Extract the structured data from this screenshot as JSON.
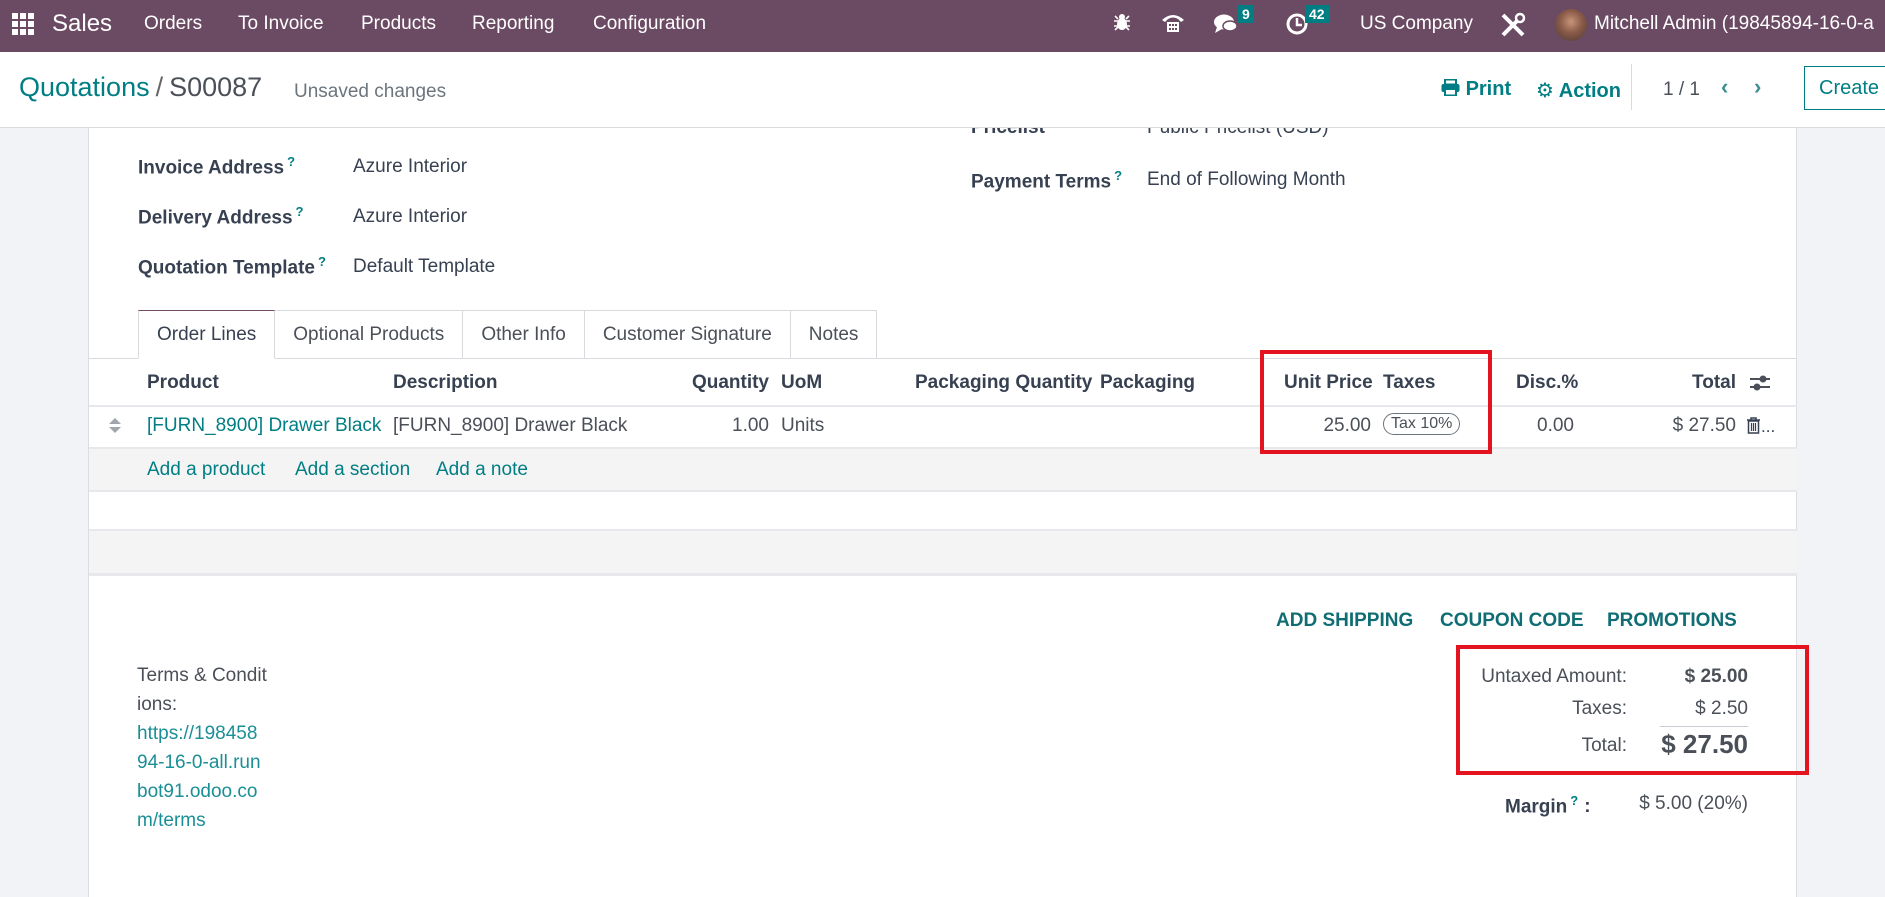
{
  "navbar": {
    "app_name": "Sales",
    "menu": [
      "Orders",
      "To Invoice",
      "Products",
      "Reporting",
      "Configuration"
    ],
    "messages_count": "9",
    "activities_count": "42",
    "company": "US Company",
    "user": "Mitchell Admin (19845894-16-0-a"
  },
  "control_panel": {
    "breadcrumb_parent": "Quotations",
    "breadcrumb_separator": "/",
    "record_name": "S00087",
    "status": "Unsaved changes",
    "print_label": "Print",
    "action_label": "Action",
    "pager": "1 / 1",
    "create_label": "Create"
  },
  "form": {
    "left_fields": [
      {
        "label": "Invoice Address",
        "value": "Azure Interior"
      },
      {
        "label": "Delivery Address",
        "value": "Azure Interior"
      },
      {
        "label": "Quotation Template",
        "value": "Default Template"
      }
    ],
    "right_fields": [
      {
        "label": "Pricelist",
        "value": "Public Pricelist (USD)"
      },
      {
        "label": "Payment Terms",
        "value": "End of Following Month"
      }
    ],
    "help_mark": "?"
  },
  "tabs": [
    "Order Lines",
    "Optional Products",
    "Other Info",
    "Customer Signature",
    "Notes"
  ],
  "order_lines": {
    "columns": [
      "Product",
      "Description",
      "Quantity",
      "UoM",
      "Packaging Quantity",
      "Packaging",
      "Unit Price",
      "Taxes",
      "Disc.%",
      "Total"
    ],
    "rows": [
      {
        "product": "[FURN_8900] Drawer Black",
        "description": "[FURN_8900] Drawer Black",
        "quantity": "1.00",
        "uom": "Units",
        "packaging_quantity": "",
        "packaging": "",
        "unit_price": "25.00",
        "taxes": "Tax 10%",
        "discount": "0.00",
        "total": "$ 27.50"
      }
    ],
    "add_links": [
      "Add a product",
      "Add a section",
      "Add a note"
    ]
  },
  "actions": [
    "ADD SHIPPING",
    "COUPON CODE",
    "PROMOTIONS"
  ],
  "terms": {
    "label": "Terms & Conditions:",
    "link": "https://19845894-16-0-all.runbot91.odoo.com/terms"
  },
  "totals": {
    "untaxed_label": "Untaxed Amount:",
    "untaxed_value": "$ 25.00",
    "taxes_label": "Taxes:",
    "taxes_value": "$ 2.50",
    "total_label": "Total:",
    "total_value": "$ 27.50",
    "margin_label": "Margin",
    "margin_colon": ":",
    "margin_value": "$ 5.00 (20%)"
  },
  "colors": {
    "navbar": "#6b4a63",
    "accent": "#017e84",
    "highlight": "#e3141f"
  }
}
